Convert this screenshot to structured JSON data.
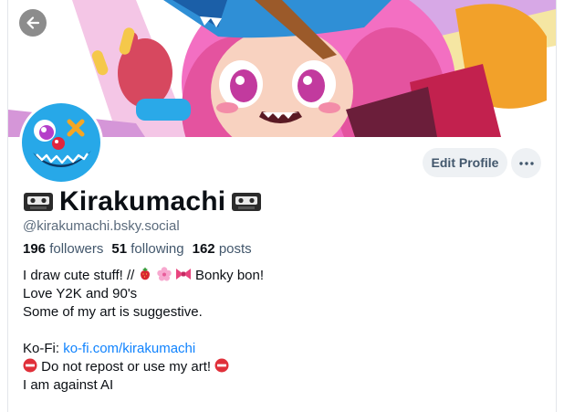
{
  "header": {
    "back_icon": "arrow-left-icon"
  },
  "profile": {
    "display_name": "Kirakumachi",
    "name_decoration_icon": "vhs-tape-icon",
    "handle": "@kirakumachi.bsky.social",
    "stats": {
      "followers_count": "196",
      "followers_label": "followers",
      "following_count": "51",
      "following_label": "following",
      "posts_count": "162",
      "posts_label": "posts"
    }
  },
  "actions": {
    "edit_label": "Edit Profile",
    "more_icon": "ellipsis-icon"
  },
  "bio": {
    "line1_prefix": "I draw cute stuff! //",
    "line1_icons": [
      "strawberry-icon",
      "cherry-blossom-icon",
      "ribbon-icon"
    ],
    "line1_suffix": "Bonky bon!",
    "line2": "Love Y2K and 90's",
    "line3": "Some of my art is suggestive.",
    "kofi_label": "Ko-Fi:",
    "kofi_link": "ko-fi.com/kirakumachi",
    "repost_text": "Do not repost or use my art!",
    "no_entry_icon": "no-entry-icon",
    "line7": "I am against AI"
  },
  "colors": {
    "accent_link": "#1083fe",
    "banner_pink": "#f266c1",
    "avatar_blue": "#27a8e8",
    "button_bg": "#eef1f4"
  }
}
